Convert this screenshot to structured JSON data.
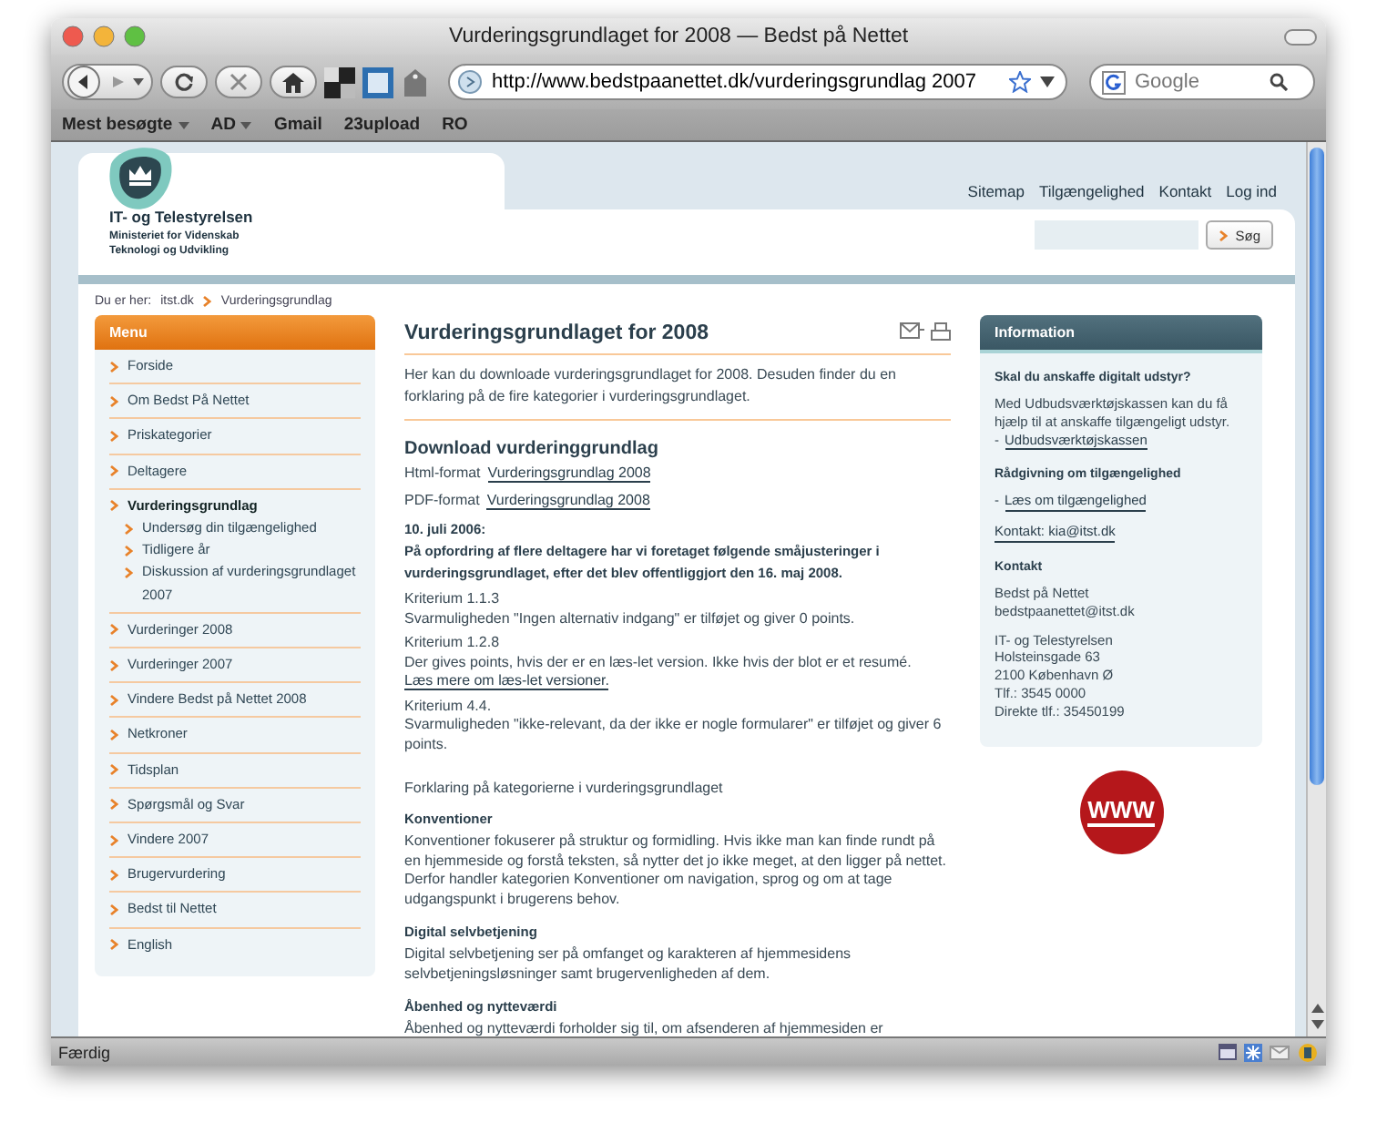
{
  "window": {
    "title": "Vurderingsgrundlaget for 2008 — Bedst på Nettet"
  },
  "toolbar": {
    "url": "http://www.bedstpaanettet.dk/vurderingsgrundlag 2007",
    "search_placeholder": "Google"
  },
  "bookmarks": [
    {
      "label": "Mest besøgte",
      "kind": "menu"
    },
    {
      "label": "AD",
      "kind": "menu"
    },
    {
      "label": "Gmail",
      "kind": "link"
    },
    {
      "label": "23upload",
      "kind": "link"
    },
    {
      "label": "RO",
      "kind": "link"
    }
  ],
  "site": {
    "org": "IT- og Telestyrelsen",
    "ministry": [
      "Ministeriet for Videnskab",
      "Teknologi og Udvikling"
    ],
    "top_links": [
      "Sitemap",
      "Tilgængelighed",
      "Kontakt",
      "Log ind"
    ],
    "search_button": "Søg"
  },
  "breadcrumb": {
    "label": "Du er her:",
    "items": [
      "itst.dk",
      "Vurderingsgrundlag"
    ]
  },
  "menu": {
    "title": "Menu",
    "items": [
      {
        "label": "Forside",
        "selected": false
      },
      {
        "label": "Om Bedst På Nettet",
        "selected": false
      },
      {
        "label": "Priskategorier",
        "selected": false
      },
      {
        "label": "Deltagere",
        "selected": false
      },
      {
        "label": "Vurderingsgrundlag",
        "selected": true,
        "children": [
          {
            "label": "Undersøg din tilgængelighed",
            "selected": false
          },
          {
            "label": "Tidligere år",
            "selected": false
          },
          {
            "label": "Diskussion af vurderingsgrundlaget 2007",
            "selected": false
          }
        ]
      },
      {
        "label": "Vurderinger 2008",
        "selected": false
      },
      {
        "label": "Vurderinger 2007",
        "selected": false
      },
      {
        "label": "Vindere Bedst på Nettet 2008",
        "selected": false
      },
      {
        "label": "Netkroner",
        "selected": false
      },
      {
        "label": "Tidsplan",
        "selected": false
      },
      {
        "label": "Spørgsmål og Svar",
        "selected": false
      },
      {
        "label": "Vindere 2007",
        "selected": false
      },
      {
        "label": "Brugervurdering",
        "selected": false
      },
      {
        "label": "Bedst til Nettet",
        "selected": false
      },
      {
        "label": "English",
        "selected": false
      }
    ]
  },
  "article": {
    "title": "Vurderingsgrundlaget for 2008",
    "intro": "Her kan du downloade vurderingsgrundlaget for 2008. Desuden finder du en forklaring på de fire kategorier i vurderingsgrundlaget.",
    "download_heading": "Download vurderinggrundlag",
    "downloads": [
      {
        "format": "Html-format",
        "link": "Vurderingsgrundlag 2008"
      },
      {
        "format": "PDF-format",
        "link": "Vurderingsgrundlag 2008"
      }
    ],
    "update_date": "10. juli 2006:",
    "update_note": "På opfordring af flere deltagere har vi foretaget følgende småjusteringer i vurderingsgrundlaget, efter det blev offentliggjort den 16. maj 2008.",
    "criteria": [
      {
        "title": "Kriterium 1.1.3",
        "text": "Svarmuligheden \"Ingen alternativ indgang\" er tilføjet og giver 0 points."
      },
      {
        "title": "Kriterium 1.2.8",
        "text": "Der gives points, hvis der er en læs-let version. Ikke hvis der blot er et resumé.",
        "link": "Læs mere om læs-let versioner."
      },
      {
        "title": "Kriterium 4.4.",
        "text": "Svarmuligheden \"ikke-relevant, da der ikke er nogle formularer\" er tilføjet og giver 6 points."
      }
    ],
    "categories_intro": "Forklaring på kategorierne i vurderingsgrundlaget",
    "categories": [
      {
        "heading": "Konventioner",
        "text": "Konventioner fokuserer på struktur og formidling. Hvis ikke man kan finde rundt på en hjemmeside og forstå teksten, så nytter det jo ikke meget, at den ligger på nettet. Derfor handler kategorien Konventioner om navigation, sprog og om at tage udgangspunkt i brugerens behov."
      },
      {
        "heading": "Digital selvbetjening",
        "text": "Digital selvbetjening ser på omfanget og karakteren af hjemmesidens selvbetjeningsløsninger samt brugervenligheden af dem."
      },
      {
        "heading": "Åbenhed og nytteværdi",
        "text": "Åbenhed og nytteværdi forholder sig til, om afsenderen af hjemmesiden er"
      }
    ]
  },
  "info": {
    "title": "Information",
    "blocks": [
      {
        "kind": "heading",
        "text": "Skal du anskaffe digitalt udstyr?"
      },
      {
        "kind": "text",
        "lines": [
          "Med Udbudsværktøjskassen kan du få hjælp til at anskaffe tilgængeligt udstyr."
        ],
        "bullet": "-",
        "link": "Udbudsværktøjskassen"
      },
      {
        "kind": "heading",
        "text": "Rådgivning om tilgængelighed"
      },
      {
        "kind": "text",
        "bullet": "-",
        "link": "Læs om tilgængelighed"
      },
      {
        "kind": "text",
        "link": "Kontakt: kia@itst.dk"
      },
      {
        "kind": "heading",
        "text": "Kontakt"
      },
      {
        "kind": "text",
        "lines": [
          "Bedst på Nettet",
          "bedstpaanettet@itst.dk"
        ]
      },
      {
        "kind": "text",
        "lines": [
          "IT- og Telestyrelsen",
          "Holsteinsgade 63",
          "2100 København Ø",
          "Tlf.: 3545 0000",
          "Direkte tlf.: 35450199"
        ]
      }
    ]
  },
  "badge": "WWW",
  "status_bar": {
    "text": "Færdig"
  }
}
